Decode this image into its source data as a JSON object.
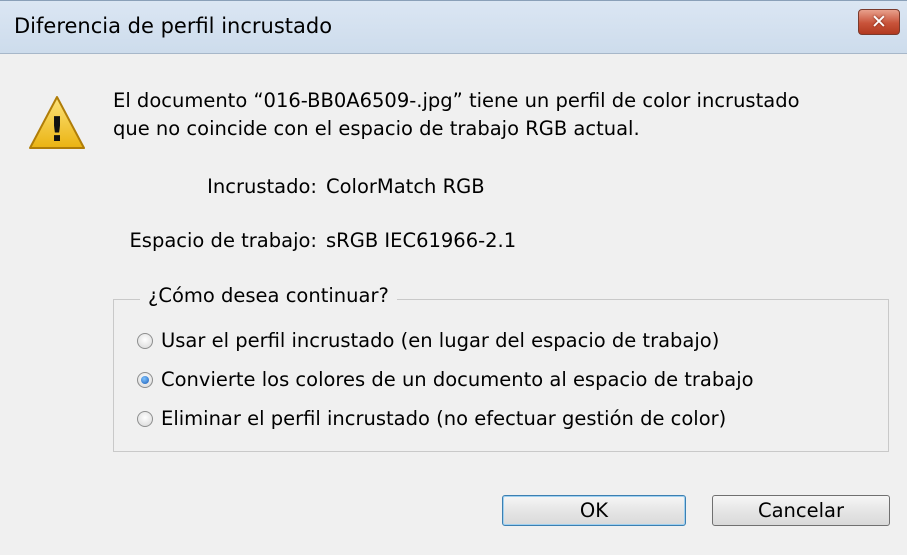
{
  "window": {
    "title": "Diferencia de perfil incrustado",
    "close_glyph": "✕"
  },
  "icon": {
    "name": "warning-icon",
    "glyph": "!"
  },
  "message": {
    "line1": "El documento “016-BB0A6509-.jpg” tiene un perfil de color incrustado",
    "line2": "que no coincide con el espacio de trabajo RGB actual."
  },
  "info": {
    "embedded_label": "Incrustado:",
    "embedded_value": "ColorMatch RGB",
    "workspace_label": "Espacio de trabajo:",
    "workspace_value": "sRGB IEC61966-2.1"
  },
  "options": {
    "legend": "¿Cómo desea continuar?",
    "items": [
      {
        "label": "Usar el perfil incrustado (en lugar del espacio de trabajo)",
        "checked": false
      },
      {
        "label": "Convierte los colores de un documento al espacio de trabajo",
        "checked": true
      },
      {
        "label": "Eliminar el perfil incrustado (no efectuar gestión de color)",
        "checked": false
      }
    ]
  },
  "buttons": {
    "ok": "OK",
    "cancel": "Cancelar"
  },
  "colors": {
    "dialog_bg": "#f0f0f0",
    "titlebar": "#cddcec",
    "close_button": "#c8533a",
    "warning": "#f2c029"
  }
}
